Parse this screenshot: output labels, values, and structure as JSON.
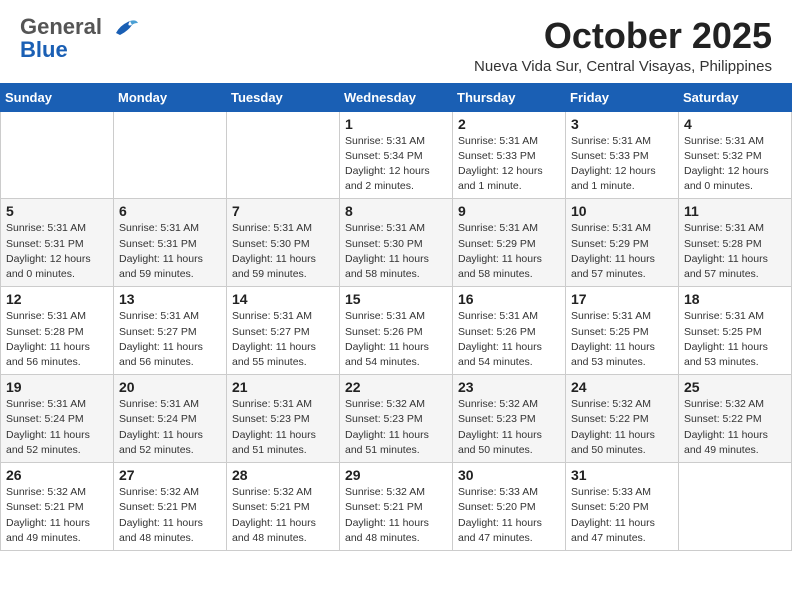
{
  "header": {
    "logo_general": "General",
    "logo_blue": "Blue",
    "month": "October 2025",
    "location": "Nueva Vida Sur, Central Visayas, Philippines"
  },
  "weekdays": [
    "Sunday",
    "Monday",
    "Tuesday",
    "Wednesday",
    "Thursday",
    "Friday",
    "Saturday"
  ],
  "weeks": [
    [
      {
        "day": "",
        "info": ""
      },
      {
        "day": "",
        "info": ""
      },
      {
        "day": "",
        "info": ""
      },
      {
        "day": "1",
        "info": "Sunrise: 5:31 AM\nSunset: 5:34 PM\nDaylight: 12 hours\nand 2 minutes."
      },
      {
        "day": "2",
        "info": "Sunrise: 5:31 AM\nSunset: 5:33 PM\nDaylight: 12 hours\nand 1 minute."
      },
      {
        "day": "3",
        "info": "Sunrise: 5:31 AM\nSunset: 5:33 PM\nDaylight: 12 hours\nand 1 minute."
      },
      {
        "day": "4",
        "info": "Sunrise: 5:31 AM\nSunset: 5:32 PM\nDaylight: 12 hours\nand 0 minutes."
      }
    ],
    [
      {
        "day": "5",
        "info": "Sunrise: 5:31 AM\nSunset: 5:31 PM\nDaylight: 12 hours\nand 0 minutes."
      },
      {
        "day": "6",
        "info": "Sunrise: 5:31 AM\nSunset: 5:31 PM\nDaylight: 11 hours\nand 59 minutes."
      },
      {
        "day": "7",
        "info": "Sunrise: 5:31 AM\nSunset: 5:30 PM\nDaylight: 11 hours\nand 59 minutes."
      },
      {
        "day": "8",
        "info": "Sunrise: 5:31 AM\nSunset: 5:30 PM\nDaylight: 11 hours\nand 58 minutes."
      },
      {
        "day": "9",
        "info": "Sunrise: 5:31 AM\nSunset: 5:29 PM\nDaylight: 11 hours\nand 58 minutes."
      },
      {
        "day": "10",
        "info": "Sunrise: 5:31 AM\nSunset: 5:29 PM\nDaylight: 11 hours\nand 57 minutes."
      },
      {
        "day": "11",
        "info": "Sunrise: 5:31 AM\nSunset: 5:28 PM\nDaylight: 11 hours\nand 57 minutes."
      }
    ],
    [
      {
        "day": "12",
        "info": "Sunrise: 5:31 AM\nSunset: 5:28 PM\nDaylight: 11 hours\nand 56 minutes."
      },
      {
        "day": "13",
        "info": "Sunrise: 5:31 AM\nSunset: 5:27 PM\nDaylight: 11 hours\nand 56 minutes."
      },
      {
        "day": "14",
        "info": "Sunrise: 5:31 AM\nSunset: 5:27 PM\nDaylight: 11 hours\nand 55 minutes."
      },
      {
        "day": "15",
        "info": "Sunrise: 5:31 AM\nSunset: 5:26 PM\nDaylight: 11 hours\nand 54 minutes."
      },
      {
        "day": "16",
        "info": "Sunrise: 5:31 AM\nSunset: 5:26 PM\nDaylight: 11 hours\nand 54 minutes."
      },
      {
        "day": "17",
        "info": "Sunrise: 5:31 AM\nSunset: 5:25 PM\nDaylight: 11 hours\nand 53 minutes."
      },
      {
        "day": "18",
        "info": "Sunrise: 5:31 AM\nSunset: 5:25 PM\nDaylight: 11 hours\nand 53 minutes."
      }
    ],
    [
      {
        "day": "19",
        "info": "Sunrise: 5:31 AM\nSunset: 5:24 PM\nDaylight: 11 hours\nand 52 minutes."
      },
      {
        "day": "20",
        "info": "Sunrise: 5:31 AM\nSunset: 5:24 PM\nDaylight: 11 hours\nand 52 minutes."
      },
      {
        "day": "21",
        "info": "Sunrise: 5:31 AM\nSunset: 5:23 PM\nDaylight: 11 hours\nand 51 minutes."
      },
      {
        "day": "22",
        "info": "Sunrise: 5:32 AM\nSunset: 5:23 PM\nDaylight: 11 hours\nand 51 minutes."
      },
      {
        "day": "23",
        "info": "Sunrise: 5:32 AM\nSunset: 5:23 PM\nDaylight: 11 hours\nand 50 minutes."
      },
      {
        "day": "24",
        "info": "Sunrise: 5:32 AM\nSunset: 5:22 PM\nDaylight: 11 hours\nand 50 minutes."
      },
      {
        "day": "25",
        "info": "Sunrise: 5:32 AM\nSunset: 5:22 PM\nDaylight: 11 hours\nand 49 minutes."
      }
    ],
    [
      {
        "day": "26",
        "info": "Sunrise: 5:32 AM\nSunset: 5:21 PM\nDaylight: 11 hours\nand 49 minutes."
      },
      {
        "day": "27",
        "info": "Sunrise: 5:32 AM\nSunset: 5:21 PM\nDaylight: 11 hours\nand 48 minutes."
      },
      {
        "day": "28",
        "info": "Sunrise: 5:32 AM\nSunset: 5:21 PM\nDaylight: 11 hours\nand 48 minutes."
      },
      {
        "day": "29",
        "info": "Sunrise: 5:32 AM\nSunset: 5:21 PM\nDaylight: 11 hours\nand 48 minutes."
      },
      {
        "day": "30",
        "info": "Sunrise: 5:33 AM\nSunset: 5:20 PM\nDaylight: 11 hours\nand 47 minutes."
      },
      {
        "day": "31",
        "info": "Sunrise: 5:33 AM\nSunset: 5:20 PM\nDaylight: 11 hours\nand 47 minutes."
      },
      {
        "day": "",
        "info": ""
      }
    ]
  ]
}
